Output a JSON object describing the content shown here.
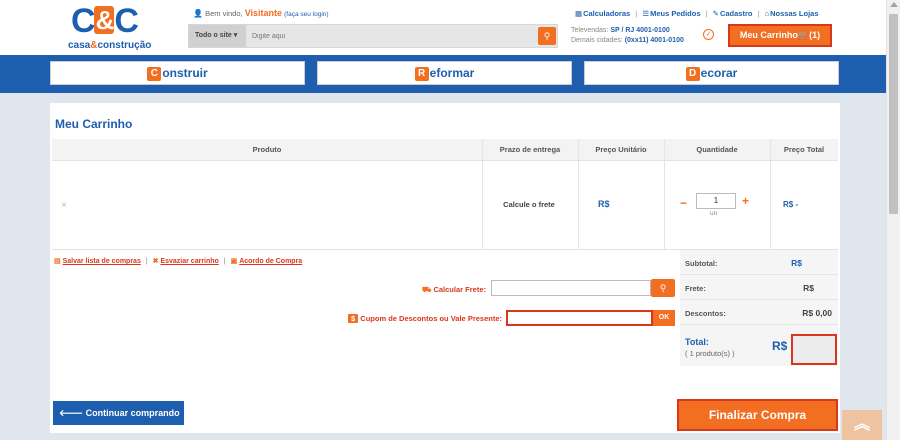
{
  "brand": {
    "logo_main": "C",
    "logo_amp": "&",
    "logo_end": "C",
    "logo_sub_a": "casa",
    "logo_sub_amp": "&",
    "logo_sub_b": "construção"
  },
  "header": {
    "welcome_text": "Bem vindo,",
    "visitor": "Visitante",
    "login_prompt": "(faça seu login)",
    "search_category": "Todo o site",
    "search_placeholder": "Digite aqui",
    "links": [
      "Calculadoras",
      "Meus Pedidos",
      "Cadastro",
      "Nossas Lojas"
    ],
    "phone_label_1": "Televendas:",
    "phone_1": "SP / RJ 4001-0100",
    "phone_label_2": "Demais cidades:",
    "phone_2": "(0xx11) 4001-0100",
    "cart_label": "Meu Carrinho",
    "cart_count": "(1)"
  },
  "nav": {
    "items": [
      {
        "letter": "C",
        "rest": "onstruir"
      },
      {
        "letter": "R",
        "rest": "eformar"
      },
      {
        "letter": "D",
        "rest": "ecorar"
      }
    ]
  },
  "cart": {
    "title": "Meu Carrinho",
    "columns": [
      "Produto",
      "Prazo de entrega",
      "Preço Unitário",
      "Quantidade",
      "Preço Total"
    ],
    "row": {
      "remove": "×",
      "delivery": "Calcule o frete",
      "unit_price": "R$",
      "quantity": "1",
      "unit": "un",
      "total": "R$ -"
    },
    "links": [
      "Salvar lista de compras",
      "Esvaziar carrinho",
      "Acordo de Compra"
    ],
    "freight_label": "Calcular Frete:",
    "coupon_label": "Cupom de Descontos ou Vale Presente:",
    "coupon_ok": "OK",
    "summary": {
      "subtotal_label": "Subtotal:",
      "subtotal_value": "R$",
      "freight_label": "Frete:",
      "freight_value": "R$",
      "discount_label": "Descontos:",
      "discount_value": "R$ 0,00",
      "total_label": "Total:",
      "total_sub": "( 1 produto(s) )",
      "total_value": "R$"
    },
    "continue_label": "Continuar comprando",
    "finalize_label": "Finalizar Compra"
  },
  "colors": {
    "brand_blue": "#1d5fae",
    "brand_orange": "#f26e21",
    "alert_red": "#d9371b"
  }
}
